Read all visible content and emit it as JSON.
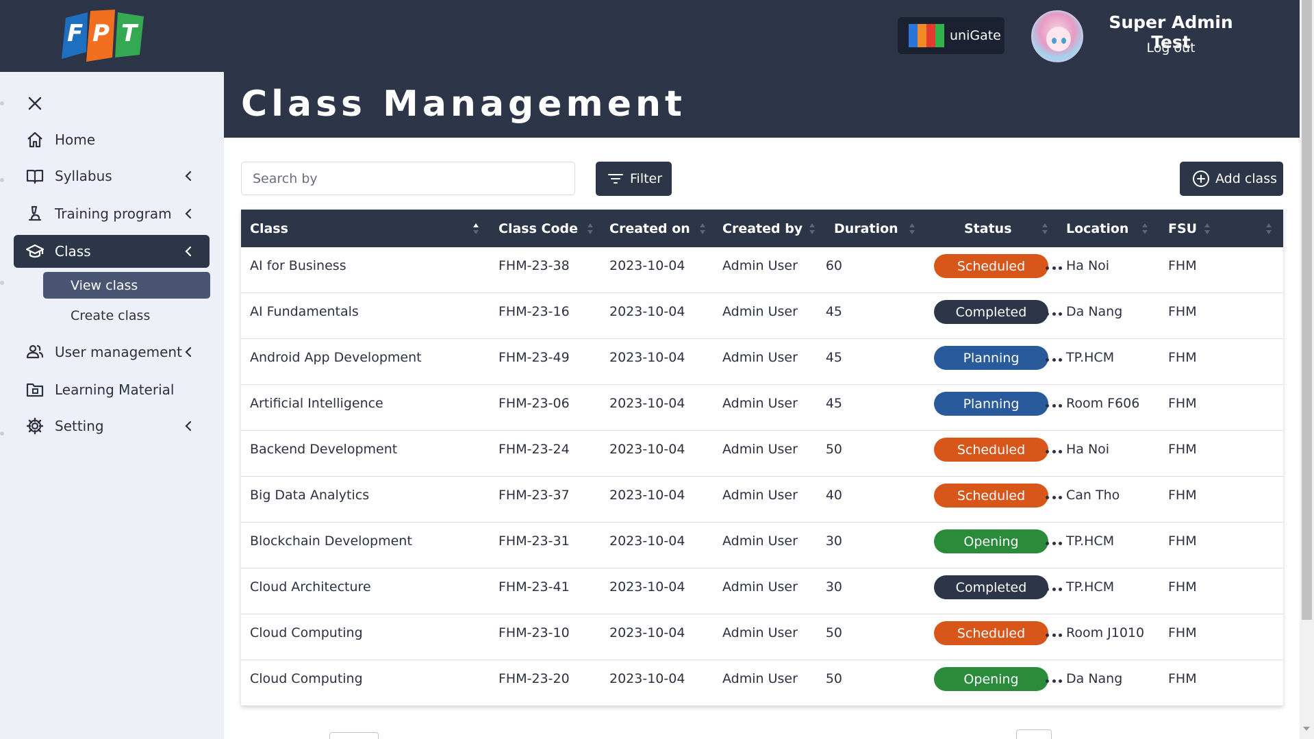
{
  "header": {
    "logo_text": "FPT",
    "unigate_label": "uniGate",
    "user_name": "Super Admin Test",
    "logout_label": "Log out"
  },
  "sidebar": {
    "items": [
      {
        "label": "Home",
        "icon": "home-icon"
      },
      {
        "label": "Syllabus",
        "icon": "book-icon"
      },
      {
        "label": "Training program",
        "icon": "microscope-icon"
      },
      {
        "label": "Class",
        "icon": "graduation-cap-icon",
        "active": true
      },
      {
        "label": "User management",
        "icon": "users-icon"
      },
      {
        "label": "Learning Material",
        "icon": "folder-icon"
      },
      {
        "label": "Setting",
        "icon": "gear-icon"
      }
    ],
    "sub_items": [
      {
        "label": "View class",
        "active": true
      },
      {
        "label": "Create class"
      }
    ]
  },
  "main": {
    "title": "Class Management",
    "search_placeholder": "Search by",
    "filter_label": "Filter",
    "add_label": "Add class"
  },
  "table": {
    "columns": [
      "Class",
      "Class Code",
      "Created on",
      "Created by",
      "Duration",
      "Status",
      "Location",
      "FSU"
    ],
    "rows": [
      {
        "class": "AI for Business",
        "code": "FHM-23-38",
        "created_on": "2023-10-04",
        "created_by": "Admin User",
        "duration": "60",
        "status": "Scheduled",
        "location": "Ha Noi",
        "fsu": "FHM"
      },
      {
        "class": "AI Fundamentals",
        "code": "FHM-23-16",
        "created_on": "2023-10-04",
        "created_by": "Admin User",
        "duration": "45",
        "status": "Completed",
        "location": "Da Nang",
        "fsu": "FHM"
      },
      {
        "class": "Android App Development",
        "code": "FHM-23-49",
        "created_on": "2023-10-04",
        "created_by": "Admin User",
        "duration": "45",
        "status": "Planning",
        "location": "TP.HCM",
        "fsu": "FHM"
      },
      {
        "class": "Artificial Intelligence",
        "code": "FHM-23-06",
        "created_on": "2023-10-04",
        "created_by": "Admin User",
        "duration": "45",
        "status": "Planning",
        "location": "Room F606",
        "fsu": "FHM"
      },
      {
        "class": "Backend Development",
        "code": "FHM-23-24",
        "created_on": "2023-10-04",
        "created_by": "Admin User",
        "duration": "50",
        "status": "Scheduled",
        "location": "Ha Noi",
        "fsu": "FHM"
      },
      {
        "class": "Big Data Analytics",
        "code": "FHM-23-37",
        "created_on": "2023-10-04",
        "created_by": "Admin User",
        "duration": "40",
        "status": "Scheduled",
        "location": "Can Tho",
        "fsu": "FHM"
      },
      {
        "class": "Blockchain Development",
        "code": "FHM-23-31",
        "created_on": "2023-10-04",
        "created_by": "Admin User",
        "duration": "30",
        "status": "Opening",
        "location": "TP.HCM",
        "fsu": "FHM"
      },
      {
        "class": "Cloud Architecture",
        "code": "FHM-23-41",
        "created_on": "2023-10-04",
        "created_by": "Admin User",
        "duration": "30",
        "status": "Completed",
        "location": "TP.HCM",
        "fsu": "FHM"
      },
      {
        "class": "Cloud Computing",
        "code": "FHM-23-10",
        "created_on": "2023-10-04",
        "created_by": "Admin User",
        "duration": "50",
        "status": "Scheduled",
        "location": "Room J1010",
        "fsu": "FHM"
      },
      {
        "class": "Cloud Computing",
        "code": "FHM-23-20",
        "created_on": "2023-10-04",
        "created_by": "Admin User",
        "duration": "50",
        "status": "Opening",
        "location": "Da Nang",
        "fsu": "FHM"
      }
    ]
  },
  "status_colors": {
    "Scheduled": "#d8561a",
    "Completed": "#2d3548",
    "Planning": "#285a9c",
    "Opening": "#2a8b3a"
  },
  "colors": {
    "primary_dark": "#2d3548",
    "sidebar_bg": "#edf0f6"
  }
}
